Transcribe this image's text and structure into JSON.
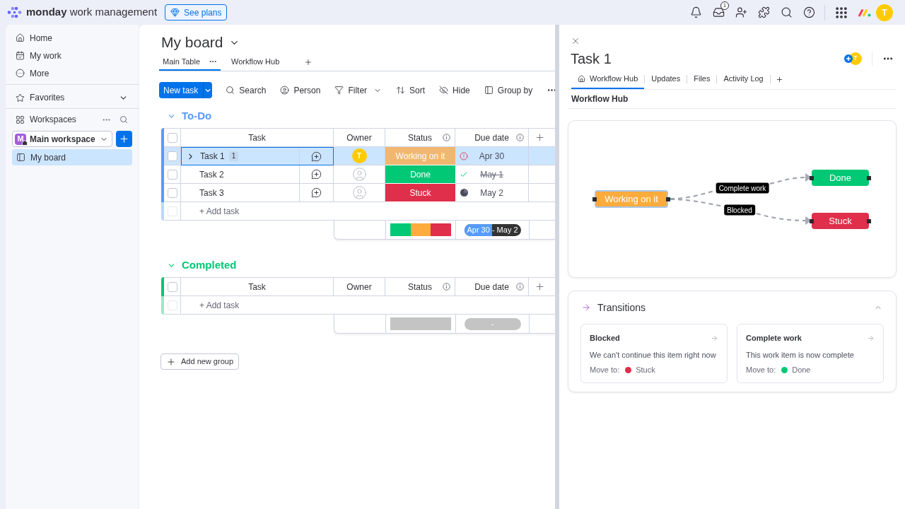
{
  "top_bar": {
    "brand": "**monday** work management",
    "plans_button": "See plans",
    "inbox_badge": "1",
    "avatar": "T"
  },
  "sidebar": {
    "nav": [
      "Home",
      "My work",
      "More"
    ],
    "favorites": {
      "label": "Favorites",
      "expanded": false
    },
    "workspaces": {
      "label": "Workspaces",
      "workspace": {
        "initial": "M",
        "name": "Main workspace"
      },
      "boards": [
        {
          "label": "My board",
          "selected": true
        }
      ]
    }
  },
  "board": {
    "title": "My board",
    "views": [
      {
        "label": "Main Table",
        "selected": true
      },
      {
        "label": "Workflow Hub",
        "selected": false
      }
    ],
    "toolbar": {
      "new_button": "New task",
      "actions": [
        {
          "label": "Search",
          "dropdown": false
        },
        {
          "label": "Person",
          "dropdown": false
        },
        {
          "label": "Filter",
          "dropdown": true
        },
        {
          "label": "Sort",
          "dropdown": false
        },
        {
          "label": "Hide",
          "dropdown": false
        },
        {
          "label": "Group by",
          "dropdown": false
        }
      ]
    },
    "groups": [
      {
        "title": "To-Do",
        "color": "#579bfc",
        "expanded": true,
        "select_all_checked": false,
        "columns": [
          "Task",
          "Owner",
          "Status",
          "Due date"
        ],
        "rows": [
          {
            "task": "Task 1",
            "subitems": "1",
            "selected": true,
            "checked": false,
            "owner": "T",
            "status": {
              "label": "Working on it",
              "color": "#f1b66f"
            },
            "due": {
              "label": "Apr 30",
              "kind": "overdue"
            }
          },
          {
            "task": "Task 2",
            "selected": false,
            "checked": false,
            "status": {
              "label": "Done",
              "color": "#00c875"
            },
            "due": {
              "label": "May 1",
              "kind": "done"
            }
          },
          {
            "task": "Task 3",
            "selected": false,
            "checked": false,
            "status": {
              "label": "Stuck",
              "color": "#df2f4a"
            },
            "due": {
              "label": "May 2",
              "kind": "pending"
            }
          }
        ],
        "add_task": {
          "placeholder": "+ Add task",
          "checkbox_checked": false,
          "checkbox_disabled": true
        },
        "summary": {
          "status_segments": [
            {
              "color": "#00c875"
            },
            {
              "color": "#fdab3d"
            },
            {
              "color": "#df2f4a"
            }
          ],
          "date_range": {
            "label": "Apr 30 - May 2",
            "level": 0.49
          }
        }
      },
      {
        "title": "Completed",
        "color": "#00c875",
        "expanded": true,
        "select_all_checked": false,
        "columns": [
          "Task",
          "Owner",
          "Status",
          "Due date"
        ],
        "add_task": {
          "placeholder": "+ Add task",
          "checkbox_checked": false,
          "checkbox_disabled": true
        },
        "summary": {
          "date_range": {
            "label": "-"
          }
        }
      }
    ],
    "add_group_button": "Add new group"
  },
  "right_panel": {
    "title": "Task 1",
    "avatar": "T",
    "tabs": [
      {
        "label": "Workflow Hub",
        "selected": true
      },
      {
        "label": "Updates",
        "selected": false
      },
      {
        "label": "Files",
        "selected": false
      },
      {
        "label": "Activity Log",
        "selected": false
      }
    ],
    "section_title": "Workflow Hub",
    "diagram": {
      "nodes": [
        {
          "label": "Working on it",
          "color": "#fdab3d",
          "selected": true
        },
        {
          "label": "Done",
          "color": "#00c875",
          "selected": false
        },
        {
          "label": "Stuck",
          "color": "#df2f4a",
          "selected": false
        }
      ],
      "edges": [
        {
          "label": "Complete work"
        },
        {
          "label": "Blocked"
        }
      ]
    },
    "transitions": {
      "title": "Transitions",
      "expanded": true,
      "items": [
        {
          "title": "Blocked",
          "description": "We can't continue this item right now",
          "move_to": "Move to:",
          "target": {
            "label": "Stuck",
            "color": "#df2f4a"
          }
        },
        {
          "title": "Complete work",
          "description": "This work item is now complete",
          "move_to": "Move to:",
          "target": {
            "label": "Done",
            "color": "#00c875"
          }
        }
      ]
    }
  }
}
